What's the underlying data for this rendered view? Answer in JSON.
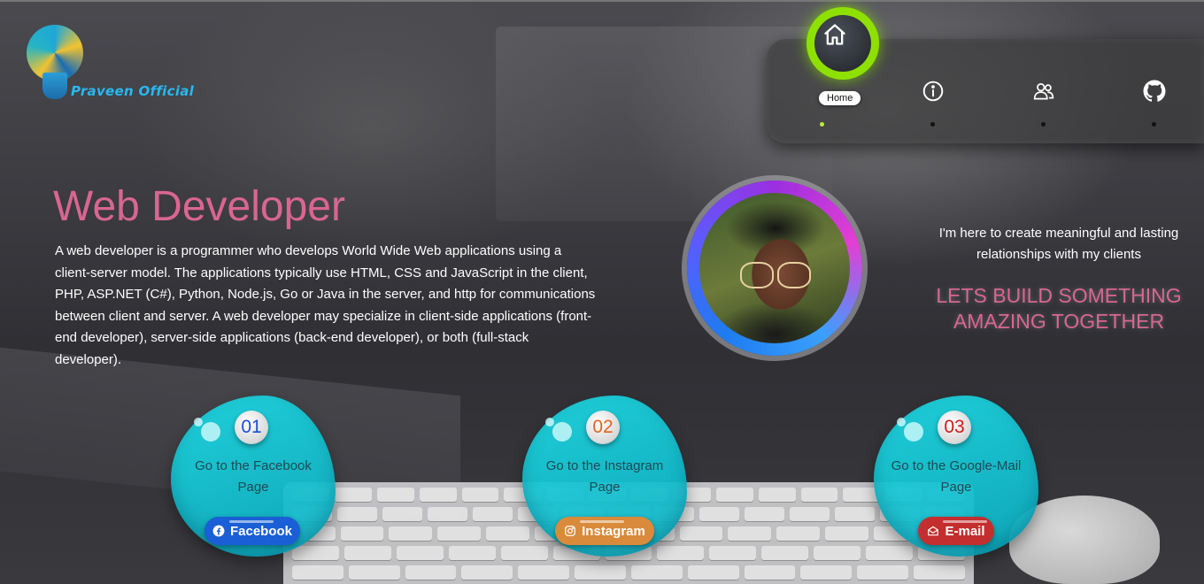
{
  "brand": {
    "name": "Praveen Official"
  },
  "nav": {
    "items": [
      {
        "label": "Home",
        "icon": "home-icon",
        "active": true
      },
      {
        "label": "",
        "icon": "info-icon",
        "active": false
      },
      {
        "label": "",
        "icon": "users-icon",
        "active": false
      },
      {
        "label": "",
        "icon": "github-icon",
        "active": false
      }
    ],
    "active_color": "#8ee000"
  },
  "hero": {
    "title": "Web Developer",
    "description": "A web developer is a programmer who develops World Wide Web applications using a client-server model. The applications typically use HTML, CSS and JavaScript in the client, PHP, ASP.NET (C#), Python, Node.js, Go or Java in the server, and http for communications between client and server. A web developer may specialize in client-side applications (front-end developer), server-side applications (back-end developer), or both (full-stack developer).",
    "title_color": "#d96690"
  },
  "profile": {
    "tagline": "I'm here to create meaningful and lasting relationships with my clients",
    "cta": "LETS BUILD SOMETHING AMAZING TOGETHER"
  },
  "cards": [
    {
      "number": "01",
      "number_color": "#1a4fd6",
      "text": "Go to the Facebook Page",
      "button": "Facebook",
      "button_icon": "facebook-icon",
      "button_color": "#1a5fd6"
    },
    {
      "number": "02",
      "number_color": "#e0661f",
      "text": "Go to the Instagram Page",
      "button": "Instagram",
      "button_icon": "instagram-icon",
      "button_color": "#d98a3a"
    },
    {
      "number": "03",
      "number_color": "#d11a1a",
      "text": "Go to the Google-Mail Page",
      "button": "E-mail",
      "button_icon": "mail-icon",
      "button_color": "#c42e2e"
    }
  ]
}
